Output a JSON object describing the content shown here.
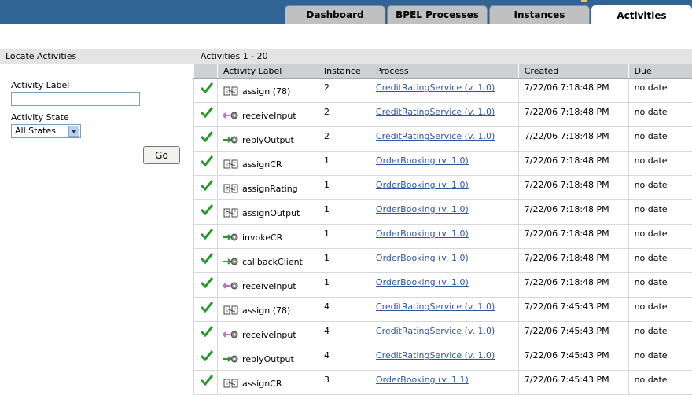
{
  "tabs": [
    {
      "label": "Dashboard",
      "active": false
    },
    {
      "label": "BPEL Processes",
      "active": false
    },
    {
      "label": "Instances",
      "active": false
    },
    {
      "label": "Activities",
      "active": true
    }
  ],
  "locate": {
    "title": "Locate Activities",
    "activity_label_caption": "Activity Label",
    "activity_label_value": "",
    "activity_state_caption": "Activity State",
    "activity_state_value": "All States",
    "go_label": "Go"
  },
  "results": {
    "title": "Activities 1 - 20",
    "columns": [
      "Activity Label",
      "Instance",
      "Process",
      "Created",
      "Due"
    ],
    "rows": [
      {
        "status_icon": "check-icon",
        "type_icon": "assign-icon",
        "label": "assign (78)",
        "instance": "2",
        "process": "CreditRatingService (v. 1.0)",
        "created": "7/22/06 7:18:48 PM",
        "due": "no date"
      },
      {
        "status_icon": "check-icon",
        "type_icon": "receive-icon",
        "label": "receiveInput",
        "instance": "2",
        "process": "CreditRatingService (v. 1.0)",
        "created": "7/22/06 7:18:48 PM",
        "due": "no date"
      },
      {
        "status_icon": "check-icon",
        "type_icon": "reply-icon",
        "label": "replyOutput",
        "instance": "2",
        "process": "CreditRatingService (v. 1.0)",
        "created": "7/22/06 7:18:48 PM",
        "due": "no date"
      },
      {
        "status_icon": "check-icon",
        "type_icon": "assign-icon",
        "label": "assignCR",
        "instance": "1",
        "process": "OrderBooking (v. 1.0)",
        "created": "7/22/06 7:18:48 PM",
        "due": "no date"
      },
      {
        "status_icon": "check-icon",
        "type_icon": "assign-icon",
        "label": "assignRating",
        "instance": "1",
        "process": "OrderBooking (v. 1.0)",
        "created": "7/22/06 7:18:48 PM",
        "due": "no date"
      },
      {
        "status_icon": "check-icon",
        "type_icon": "assign-icon",
        "label": "assignOutput",
        "instance": "1",
        "process": "OrderBooking (v. 1.0)",
        "created": "7/22/06 7:18:48 PM",
        "due": "no date"
      },
      {
        "status_icon": "check-icon",
        "type_icon": "invoke-icon",
        "label": "invokeCR",
        "instance": "1",
        "process": "OrderBooking (v. 1.0)",
        "created": "7/22/06 7:18:48 PM",
        "due": "no date"
      },
      {
        "status_icon": "check-icon",
        "type_icon": "invoke-icon",
        "label": "callbackClient",
        "instance": "1",
        "process": "OrderBooking (v. 1.0)",
        "created": "7/22/06 7:18:48 PM",
        "due": "no date"
      },
      {
        "status_icon": "check-icon",
        "type_icon": "receive-icon",
        "label": "receiveInput",
        "instance": "1",
        "process": "OrderBooking (v. 1.0)",
        "created": "7/22/06 7:18:48 PM",
        "due": "no date"
      },
      {
        "status_icon": "check-icon",
        "type_icon": "assign-icon",
        "label": "assign (78)",
        "instance": "4",
        "process": "CreditRatingService (v. 1.0)",
        "created": "7/22/06 7:45:43 PM",
        "due": "no date"
      },
      {
        "status_icon": "check-icon",
        "type_icon": "receive-icon",
        "label": "receiveInput",
        "instance": "4",
        "process": "CreditRatingService (v. 1.0)",
        "created": "7/22/06 7:45:43 PM",
        "due": "no date"
      },
      {
        "status_icon": "check-icon",
        "type_icon": "reply-icon",
        "label": "replyOutput",
        "instance": "4",
        "process": "CreditRatingService (v. 1.0)",
        "created": "7/22/06 7:45:43 PM",
        "due": "no date"
      },
      {
        "status_icon": "check-icon",
        "type_icon": "assign-icon",
        "label": "assignCR",
        "instance": "3",
        "process": "OrderBooking (v. 1.1)",
        "created": "7/22/06 7:45:43 PM",
        "due": "no date"
      }
    ]
  },
  "colors": {
    "header_blue": "#2f6494",
    "link": "#2e55a5",
    "check_green": "#2a9a2a"
  }
}
